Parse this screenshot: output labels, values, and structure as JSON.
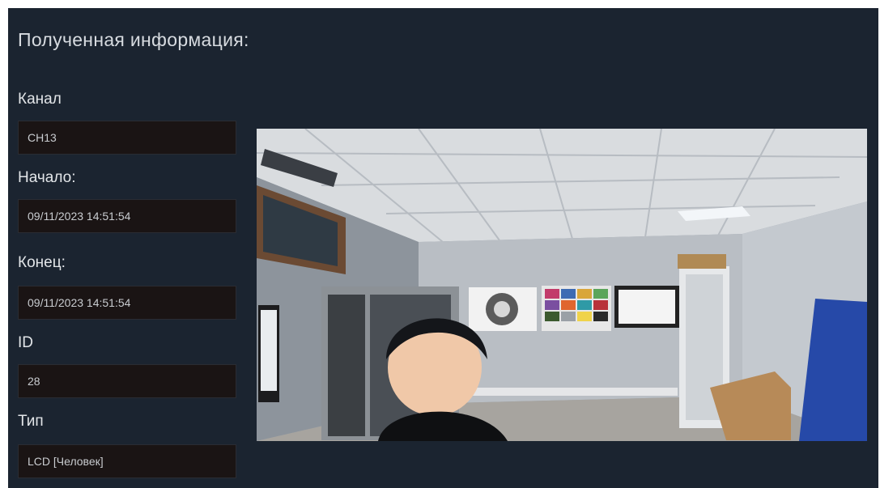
{
  "panel": {
    "title": "Полученная информация:"
  },
  "fields": [
    {
      "label": "Канал",
      "value": "CH13"
    },
    {
      "label": "Начало:",
      "value": "09/11/2023 14:51:54"
    },
    {
      "label": "Конец:",
      "value": "09/11/2023 14:51:54"
    },
    {
      "label": "ID",
      "value": "28"
    },
    {
      "label": "Тип",
      "value": "LCD [Человек]"
    }
  ],
  "colors": {
    "panel_bg": "#1b2430",
    "field_bg": "#1a1414",
    "text": "#e2e5e8"
  }
}
